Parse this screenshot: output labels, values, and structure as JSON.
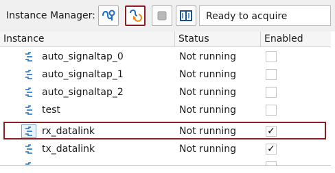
{
  "toolbar": {
    "label": "Instance Manager:",
    "status_text": "Ready to acquire",
    "buttons": [
      {
        "icon": "autorun-analysis-icon"
      },
      {
        "icon": "run-analysis-icon",
        "highlighted": true
      },
      {
        "icon": "stop-analysis-icon"
      },
      {
        "icon": "read-data-icon"
      }
    ]
  },
  "table": {
    "columns": [
      "Instance",
      "Status",
      "Enabled"
    ],
    "rows": [
      {
        "name": "auto_signaltap_0",
        "status": "Not running",
        "enabled": false
      },
      {
        "name": "auto_signaltap_1",
        "status": "Not running",
        "enabled": false
      },
      {
        "name": "auto_signaltap_2",
        "status": "Not running",
        "enabled": false
      },
      {
        "name": "test",
        "status": "Not running",
        "enabled": false
      },
      {
        "name": "rx_datalink",
        "status": "Not running",
        "enabled": true,
        "selected": true
      },
      {
        "name": "tx_datalink",
        "status": "Not running",
        "enabled": true
      }
    ],
    "check_glyph": "✓"
  },
  "colors": {
    "highlight": "#8b1c22",
    "icon_blue": "#1c6fc4"
  }
}
